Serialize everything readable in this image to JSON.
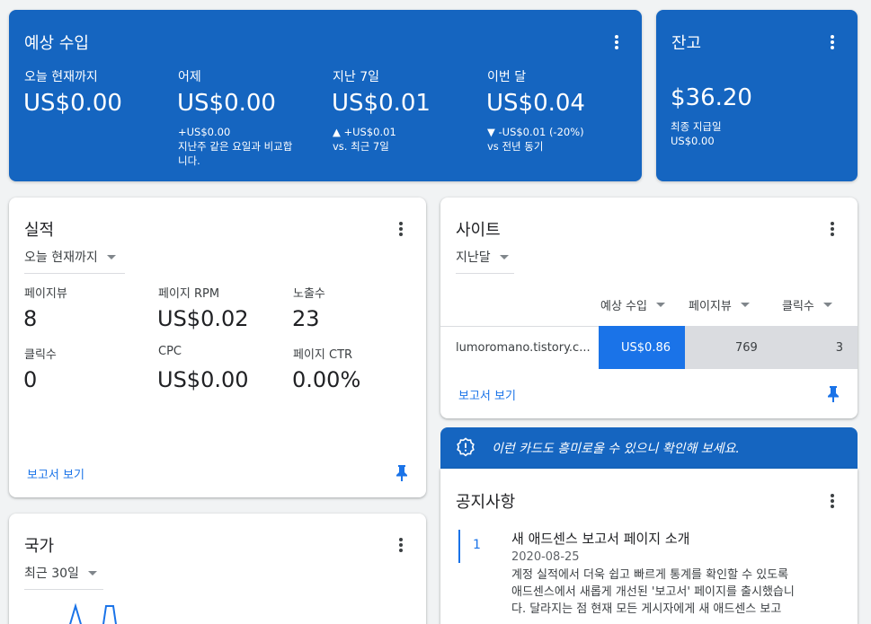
{
  "estimated_earnings": {
    "title": "예상 수입",
    "columns": [
      {
        "label": "오늘 현재까지",
        "value": "US$0.00",
        "sub": []
      },
      {
        "label": "어제",
        "value": "US$0.00",
        "sub": [
          "+US$0.00",
          "지난주 같은 요일과 비교합",
          "니다."
        ]
      },
      {
        "label": "지난 7일",
        "value": "US$0.01",
        "sub": [
          "▲ +US$0.01",
          "vs. 최근 7일"
        ]
      },
      {
        "label": "이번 달",
        "value": "US$0.04",
        "sub": [
          "▼ -US$0.01 (-20%)",
          "vs 전년 동기"
        ]
      }
    ]
  },
  "balance": {
    "title": "잔고",
    "value": "$36.20",
    "last_payment_label": "최종 지급일",
    "last_payment_value": "US$0.00"
  },
  "performance": {
    "title": "실적",
    "period": "오늘 현재까지",
    "metrics": [
      {
        "label": "페이지뷰",
        "value": "8"
      },
      {
        "label": "페이지 RPM",
        "value": "US$0.02"
      },
      {
        "label": "노출수",
        "value": "23"
      },
      {
        "label": "클릭수",
        "value": "0"
      },
      {
        "label": "CPC",
        "value": "US$0.00"
      },
      {
        "label": "페이지 CTR",
        "value": "0.00%"
      }
    ],
    "report_link": "보고서 보기"
  },
  "sites": {
    "title": "사이트",
    "period": "지난달",
    "columns": [
      "예상 수입",
      "페이지뷰",
      "클릭수"
    ],
    "rows": [
      {
        "site": "lumoromano.tistory.c...",
        "earnings": "US$0.86",
        "pageviews": "769",
        "clicks": "3"
      }
    ],
    "report_link": "보고서 보기"
  },
  "country": {
    "title": "국가",
    "period": "최근 30일"
  },
  "promo": {
    "text": "이런 카드도 흥미로울 수 있으니 확인해 보세요."
  },
  "notices": {
    "title": "공지사항",
    "items": [
      {
        "number": "1",
        "title": "새 애드센스 보고서 페이지 소개",
        "date": "2020-08-25",
        "lines": [
          "계정 실적에서 더욱 쉽고 빠르게 통계를 확인할 수 있도록",
          "애드센스에서 새롭게 개선된 '보고서' 페이지를 출시했습니",
          "다. 달라지는 점 현재 모든 게시자에게 새 애드센스 보고"
        ]
      }
    ]
  },
  "colors": {
    "blue_card": "#1565c0",
    "accent": "#1a73e8",
    "bar_gray": "#dadce0"
  }
}
